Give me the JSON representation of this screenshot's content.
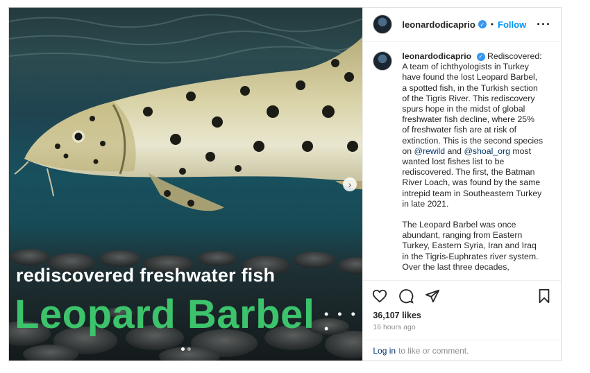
{
  "post": {
    "username": "leonardodicaprio",
    "follow_label": "Follow",
    "header_separator": "•",
    "more_icon": "more-options-icon",
    "verified_icon": "verified-badge-icon"
  },
  "media": {
    "overlay_subtitle": "rediscovered freshwater fish",
    "overlay_title": "Leopard Barbel",
    "overlay_dots": "• • • •",
    "next_icon": "chevron-right-icon",
    "carousel_count": 2,
    "carousel_active": 1,
    "accent_color": "#3cc36b"
  },
  "caption": {
    "username": "leonardodicaprio",
    "part1": "Rediscovered: A team of ichthyologists in Turkey have found the lost Leopard Barbel, a spotted fish, in the Turkish section of the Tigris River. This rediscovery spurs hope in the midst of global freshwater fish decline, where 25% of freshwater fish are at risk of extinction. This is the second species on ",
    "mention1": "@rewild",
    "part2": " and ",
    "mention2": "@shoal_org",
    "part3": " most wanted lost fishes list to be rediscovered. The first, the Batman River Loach, was found by the same intrepid team in Southeastern Turkey in late 2021.",
    "paragraph2": "The Leopard Barbel was once abundant, ranging from Eastern Turkey, Eastern Syria, Iran and Iraq in the Tigris-Euphrates river system. Over the last three decades,"
  },
  "actions": {
    "like_icon": "heart-icon",
    "comment_icon": "comment-icon",
    "share_icon": "share-icon",
    "save_icon": "bookmark-icon"
  },
  "stats": {
    "likes": "36,107 likes",
    "time": "16 hours ago"
  },
  "footer": {
    "login_link": "Log in",
    "login_text": "to like or comment."
  },
  "colors": {
    "link_blue": "#0095f6",
    "mention_blue": "#00376b",
    "muted": "#8e8e8e"
  }
}
